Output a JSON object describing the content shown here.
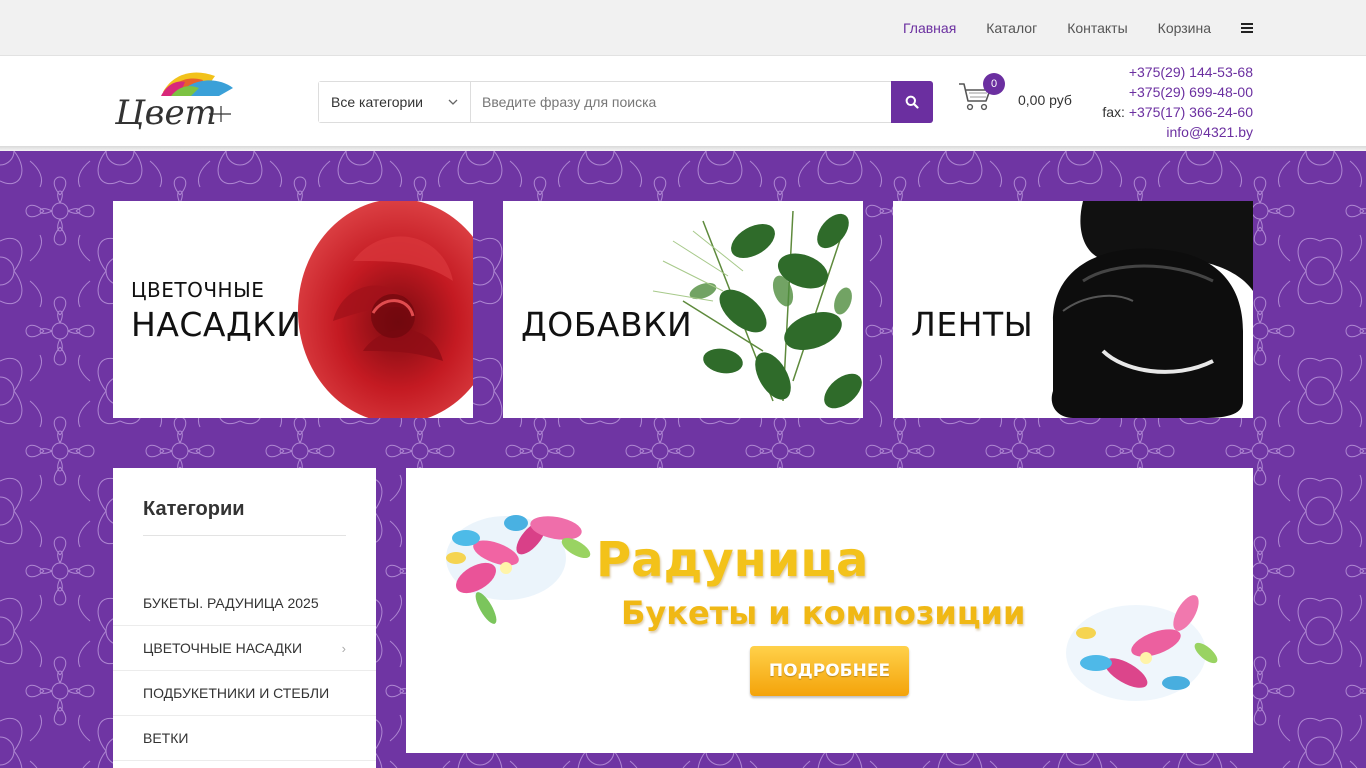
{
  "nav": {
    "items": [
      {
        "label": "Главная"
      },
      {
        "label": "Каталог"
      },
      {
        "label": "Контакты"
      },
      {
        "label": "Корзина"
      }
    ],
    "menu_icon": "hamburger-icon"
  },
  "header": {
    "logo_text": "Цвет",
    "search": {
      "category_selected": "Все категории",
      "placeholder": "Введите фразу для поиска",
      "button_icon": "search-icon"
    },
    "cart": {
      "count": "0",
      "total": "0,00 руб",
      "icon": "cart-icon"
    },
    "contacts": {
      "phone1": "+375(29) 144-53-68",
      "phone2": "+375(29) 699-48-00",
      "fax_label": "fax:",
      "fax": "+375(17) 366-24-60",
      "email": "info@4321.by"
    }
  },
  "banners": [
    {
      "line1": "ЦВЕТОЧНЫЕ",
      "line2": "НАСАДКИ"
    },
    {
      "line1": "",
      "line2": "ДОБАВКИ"
    },
    {
      "line1": "",
      "line2": "ЛЕНТЫ"
    }
  ],
  "sidebar": {
    "title": "Категории",
    "items": [
      {
        "label": "Букеты. Радуница 2025"
      },
      {
        "label": "Цветочные насадки",
        "has_children": true
      },
      {
        "label": "Подбукетники и стебли"
      },
      {
        "label": "Ветки"
      }
    ]
  },
  "slider": {
    "title": "Радуница",
    "subtitle": "Букеты и композиции",
    "button_label": "ПОДРОБНЕЕ"
  },
  "colors": {
    "accent": "#6b2fa0",
    "pattern_bg": "#6f35a3",
    "slide_gold": "#f3c21a"
  }
}
